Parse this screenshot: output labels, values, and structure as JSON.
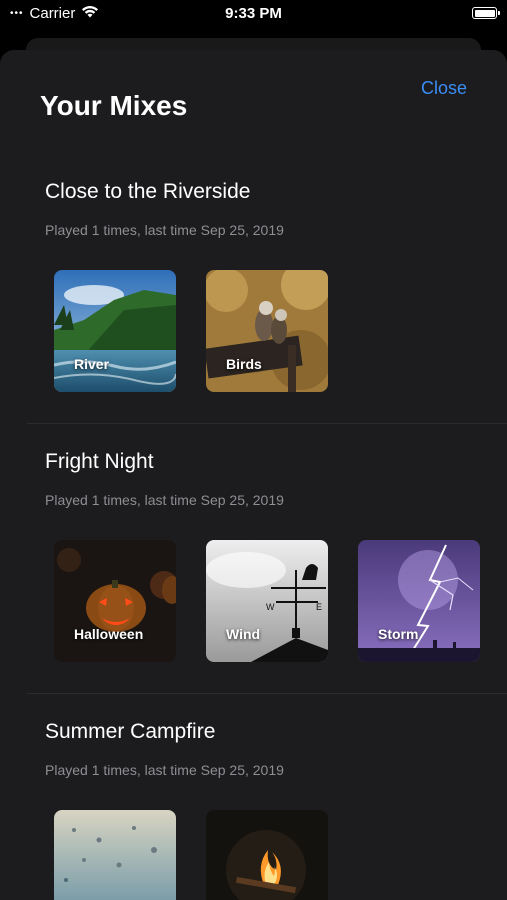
{
  "status_bar": {
    "carrier": "Carrier",
    "time": "9:33 PM",
    "wifi_icon": "wifi-icon",
    "battery_icon": "battery-icon"
  },
  "header": {
    "title": "Your Mixes",
    "close_label": "Close",
    "accent_color": "#3a8df5"
  },
  "mixes": [
    {
      "title": "Close to the Riverside",
      "meta": "Played 1 times, last time Sep 25, 2019",
      "sounds": [
        {
          "label": "River",
          "image": "river-forest-image"
        },
        {
          "label": "Birds",
          "image": "birds-on-sign-image"
        }
      ]
    },
    {
      "title": "Fright Night",
      "meta": "Played 1 times, last time Sep 25, 2019",
      "sounds": [
        {
          "label": "Halloween",
          "image": "jack-o-lantern-image"
        },
        {
          "label": "Wind",
          "image": "weather-vane-image"
        },
        {
          "label": "Storm",
          "image": "lightning-storm-image"
        }
      ]
    },
    {
      "title": "Summer Campfire",
      "meta": "Played 1 times, last time Sep 25, 2019",
      "sounds": [
        {
          "label": "",
          "image": "rain-drops-image"
        },
        {
          "label": "",
          "image": "campfire-image"
        }
      ]
    }
  ]
}
